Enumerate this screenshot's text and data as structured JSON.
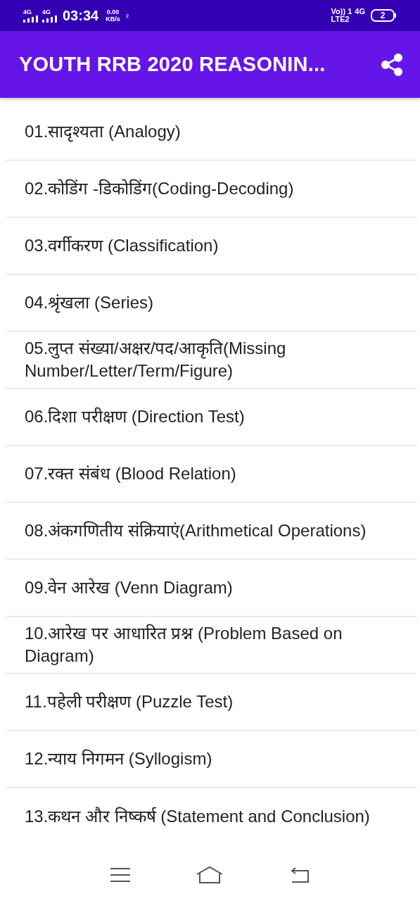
{
  "status_bar": {
    "sim1_network": "4G",
    "sim2_network": "4G",
    "time": "03:34",
    "speed_value": "0.00",
    "speed_unit": "KB/s",
    "hotspot_count": "2",
    "volte": "Vo))",
    "volte_sim": "1",
    "lte": "LTE2",
    "network": "4G",
    "battery": "2"
  },
  "app_bar": {
    "title": "YOUTH RRB 2020 REASONIN..."
  },
  "topics": [
    {
      "label": "01.सादृश्यता (Analogy)"
    },
    {
      "label": "02.कोडिंग -डिकोडिंग(Coding-Decoding)"
    },
    {
      "label": "03.वर्गीकरण (Classification)"
    },
    {
      "label": "04.श्रृंखला (Series)"
    },
    {
      "label": "05.लुप्त संख्या/अक्षर/पद/आकृति(Missing Number/Letter/Term/Figure)"
    },
    {
      "label": "06.दिशा परीक्षण (Direction Test)"
    },
    {
      "label": "07.रक्त संबंध (Blood Relation)"
    },
    {
      "label": "08.अंकगणितीय संक्रियाएं(Arithmetical Operations)"
    },
    {
      "label": "09.वेन आरेख (Venn Diagram)"
    },
    {
      "label": "10.आरेख पर आधारित प्रश्न (Problem Based on Diagram)"
    },
    {
      "label": "11.पहेली परीक्षण (Puzzle Test)"
    },
    {
      "label": "12.न्याय निगमन (Syllogism)"
    },
    {
      "label": "13.कथन और निष्कर्ष (Statement and Conclusion)"
    }
  ]
}
